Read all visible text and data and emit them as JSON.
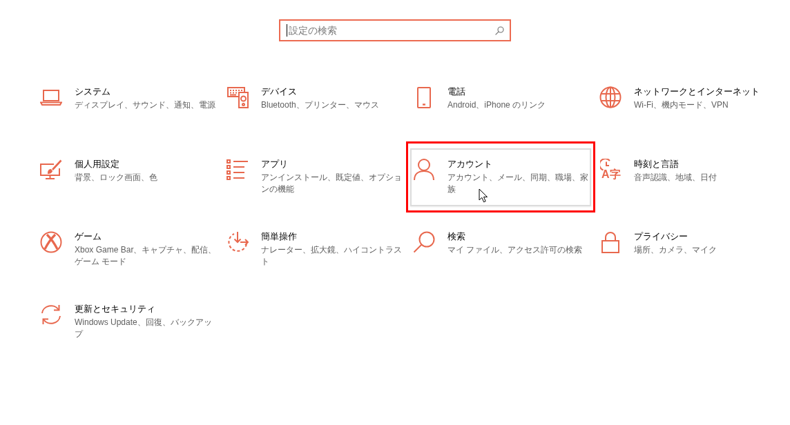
{
  "search": {
    "placeholder": "設定の検索",
    "focused": true
  },
  "tiles": [
    {
      "kind": "system",
      "title": "システム",
      "description": "ディスプレイ、サウンド、通知、電源",
      "hovered": false,
      "marked": false
    },
    {
      "kind": "devices",
      "title": "デバイス",
      "description": "Bluetooth、プリンター、マウス",
      "hovered": false,
      "marked": false
    },
    {
      "kind": "phone",
      "title": "電話",
      "description": "Android、iPhone のリンク",
      "hovered": false,
      "marked": false
    },
    {
      "kind": "network",
      "title": "ネットワークとインターネット",
      "description": "Wi-Fi、機内モード、VPN",
      "hovered": false,
      "marked": false
    },
    {
      "kind": "personalization",
      "title": "個人用設定",
      "description": "背景、ロック画面、色",
      "hovered": false,
      "marked": false
    },
    {
      "kind": "apps",
      "title": "アプリ",
      "description": "アンインストール、既定値、オプションの機能",
      "hovered": false,
      "marked": false
    },
    {
      "kind": "accounts",
      "title": "アカウント",
      "description": "アカウント、メール、同期、職場、家族",
      "hovered": true,
      "marked": true
    },
    {
      "kind": "time-language",
      "title": "時刻と言語",
      "description": "音声認識、地域、日付",
      "icon_text": "A字",
      "hovered": false,
      "marked": false
    },
    {
      "kind": "gaming",
      "title": "ゲーム",
      "description": "Xbox Game Bar、キャプチャ、配信、ゲーム モード",
      "hovered": false,
      "marked": false
    },
    {
      "kind": "ease-of-access",
      "title": "簡単操作",
      "description": "ナレーター、拡大鏡、ハイコントラスト",
      "hovered": false,
      "marked": false
    },
    {
      "kind": "search",
      "title": "検索",
      "description": "マイ ファイル、アクセス許可の検索",
      "hovered": false,
      "marked": false
    },
    {
      "kind": "privacy",
      "title": "プライバシー",
      "description": "場所、カメラ、マイク",
      "hovered": false,
      "marked": false
    },
    {
      "kind": "update",
      "title": "更新とセキュリティ",
      "description": "Windows Update、回復、バックアップ",
      "hovered": false,
      "marked": false
    }
  ]
}
